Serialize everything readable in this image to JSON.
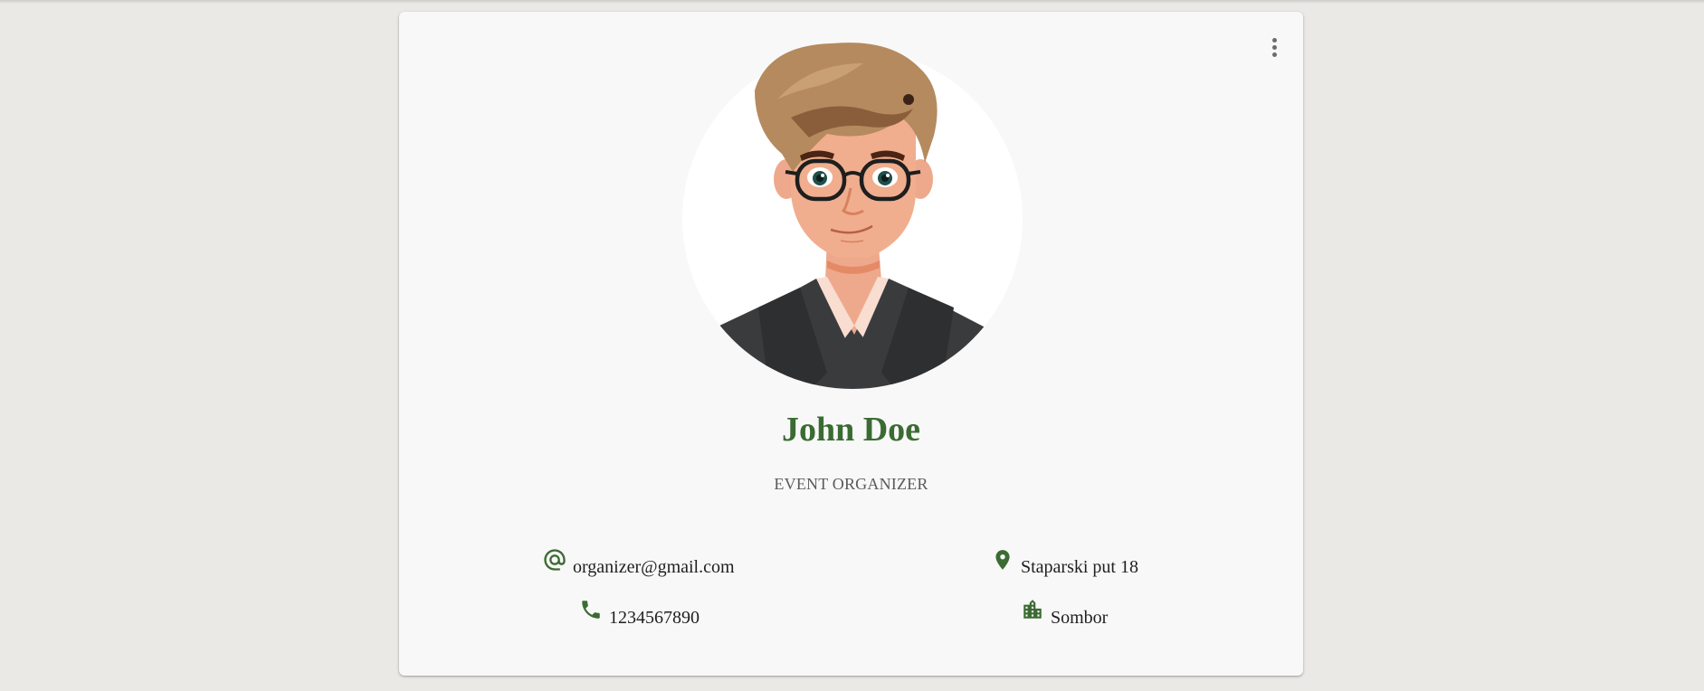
{
  "profile": {
    "name": "John Doe",
    "role": "EVENT ORGANIZER",
    "avatar_icon": "avatar-illustration"
  },
  "contact": {
    "email": "organizer@gmail.com",
    "phone": "1234567890",
    "address": "Staparski put 18",
    "city": "Sombor"
  },
  "icons": {
    "menu": "more-vert-icon",
    "email": "at-sign-icon",
    "phone": "phone-icon",
    "address": "location-pin-icon",
    "city": "city-icon"
  },
  "colors": {
    "accent": "#3b6b33",
    "background": "#ebe9e5",
    "card": "#f8f8f8"
  }
}
